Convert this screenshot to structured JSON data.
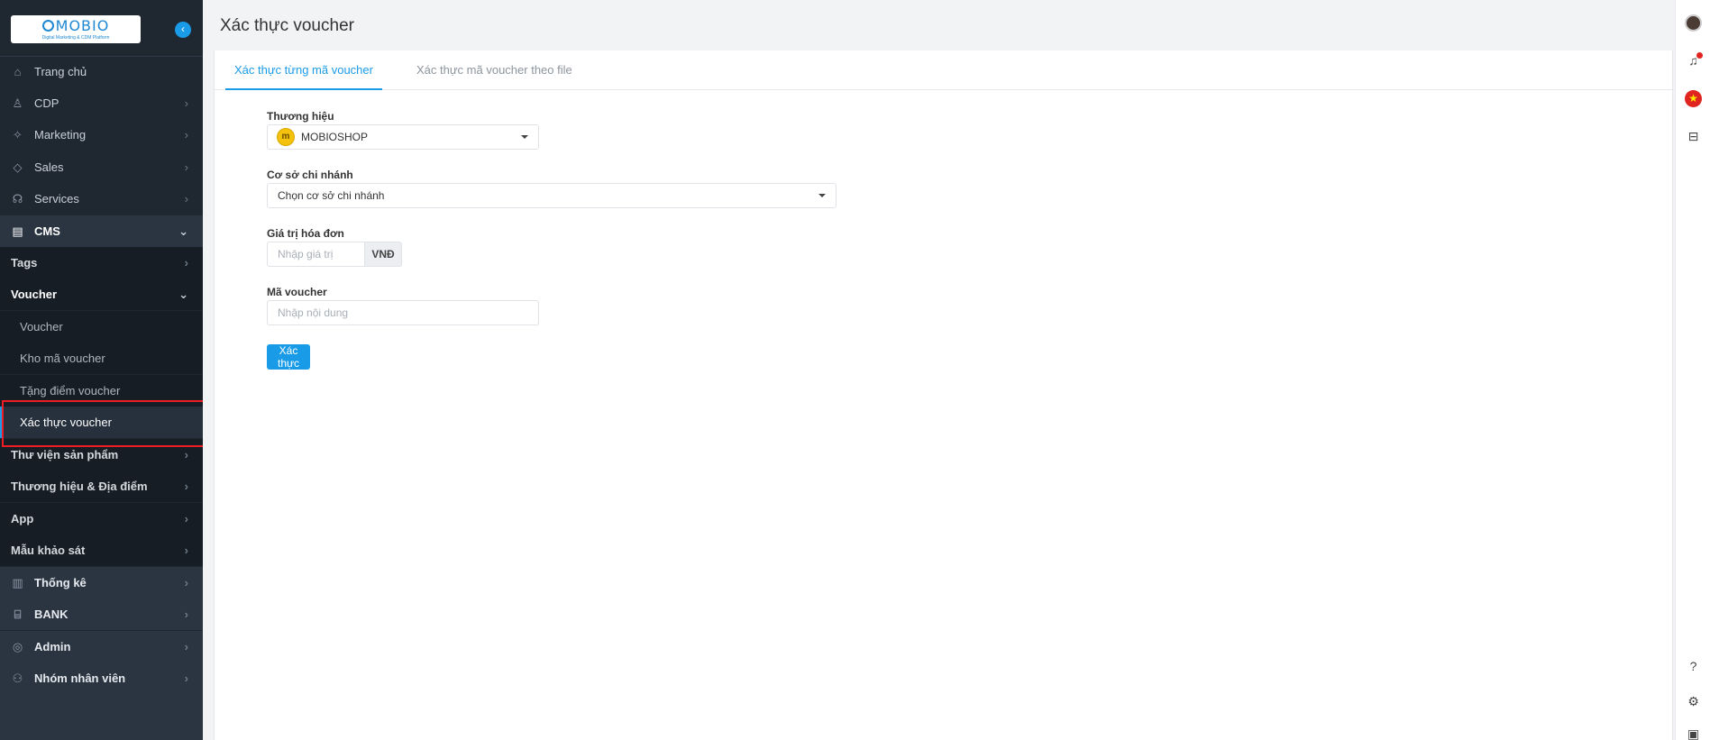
{
  "brand": {
    "logo_text": "MOBIO",
    "logo_tagline": "Digital Marketing & CDM Platform"
  },
  "sidebar": {
    "items": [
      {
        "label": "Trang chủ",
        "icon": "home-icon"
      },
      {
        "label": "CDP",
        "icon": "user-icon"
      },
      {
        "label": "Marketing",
        "icon": "megaphone-icon"
      },
      {
        "label": "Sales",
        "icon": "tag-icon"
      },
      {
        "label": "Services",
        "icon": "hand-icon"
      },
      {
        "label": "CMS",
        "icon": "document-icon"
      }
    ],
    "cms_children": [
      {
        "label": "Tags"
      },
      {
        "label": "Voucher"
      }
    ],
    "voucher_children": [
      {
        "label": "Voucher"
      },
      {
        "label": "Kho mã voucher"
      },
      {
        "label": "Tặng điểm voucher"
      },
      {
        "label": "Xác thực voucher"
      }
    ],
    "cms_more": [
      {
        "label": "Thư viện sản phẩm"
      },
      {
        "label": "Thương hiệu & Địa điểm"
      },
      {
        "label": "App"
      },
      {
        "label": "Mẫu khảo sát"
      }
    ],
    "bottom_items": [
      {
        "label": "Thống kê",
        "icon": "chart-icon"
      },
      {
        "label": "BANK",
        "icon": "bank-icon"
      },
      {
        "label": "Admin",
        "icon": "admin-icon"
      },
      {
        "label": "Nhóm nhân viên",
        "icon": "team-icon"
      }
    ]
  },
  "header": {
    "title": "Xác thực voucher"
  },
  "tabs": [
    {
      "label": "Xác thực từng mã voucher",
      "active": true
    },
    {
      "label": "Xác thực mã voucher theo file",
      "active": false
    }
  ],
  "form": {
    "brand_label": "Thương hiệu",
    "brand_value": "MOBIOSHOP",
    "branch_label": "Cơ sở chi nhánh",
    "branch_value": "Chọn cơ sở chi nhánh",
    "invoice_label": "Giá trị hóa đơn",
    "invoice_placeholder": "Nhập giá trị",
    "currency": "VNĐ",
    "voucher_label": "Mã voucher",
    "voucher_placeholder": "Nhập nội dung",
    "submit_label": "Xác thực"
  },
  "colors": {
    "accent": "#1a9be8",
    "sidebar_bg": "#1f2731",
    "highlight": "#ee1c25"
  }
}
